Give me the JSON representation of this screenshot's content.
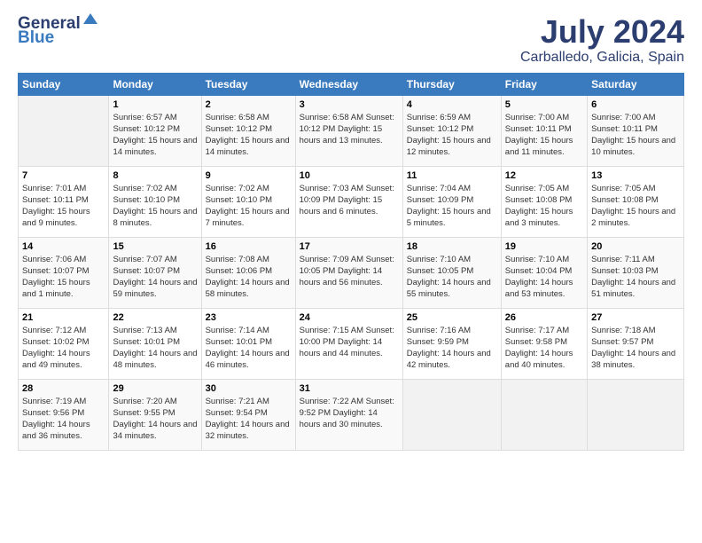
{
  "header": {
    "logo_general": "General",
    "logo_blue": "Blue",
    "month_year": "July 2024",
    "location": "Carballedo, Galicia, Spain"
  },
  "calendar": {
    "headers": [
      "Sunday",
      "Monday",
      "Tuesday",
      "Wednesday",
      "Thursday",
      "Friday",
      "Saturday"
    ],
    "rows": [
      [
        {
          "day": "",
          "info": ""
        },
        {
          "day": "1",
          "info": "Sunrise: 6:57 AM\nSunset: 10:12 PM\nDaylight: 15 hours\nand 14 minutes."
        },
        {
          "day": "2",
          "info": "Sunrise: 6:58 AM\nSunset: 10:12 PM\nDaylight: 15 hours\nand 14 minutes."
        },
        {
          "day": "3",
          "info": "Sunrise: 6:58 AM\nSunset: 10:12 PM\nDaylight: 15 hours\nand 13 minutes."
        },
        {
          "day": "4",
          "info": "Sunrise: 6:59 AM\nSunset: 10:12 PM\nDaylight: 15 hours\nand 12 minutes."
        },
        {
          "day": "5",
          "info": "Sunrise: 7:00 AM\nSunset: 10:11 PM\nDaylight: 15 hours\nand 11 minutes."
        },
        {
          "day": "6",
          "info": "Sunrise: 7:00 AM\nSunset: 10:11 PM\nDaylight: 15 hours\nand 10 minutes."
        }
      ],
      [
        {
          "day": "7",
          "info": "Sunrise: 7:01 AM\nSunset: 10:11 PM\nDaylight: 15 hours\nand 9 minutes."
        },
        {
          "day": "8",
          "info": "Sunrise: 7:02 AM\nSunset: 10:10 PM\nDaylight: 15 hours\nand 8 minutes."
        },
        {
          "day": "9",
          "info": "Sunrise: 7:02 AM\nSunset: 10:10 PM\nDaylight: 15 hours\nand 7 minutes."
        },
        {
          "day": "10",
          "info": "Sunrise: 7:03 AM\nSunset: 10:09 PM\nDaylight: 15 hours\nand 6 minutes."
        },
        {
          "day": "11",
          "info": "Sunrise: 7:04 AM\nSunset: 10:09 PM\nDaylight: 15 hours\nand 5 minutes."
        },
        {
          "day": "12",
          "info": "Sunrise: 7:05 AM\nSunset: 10:08 PM\nDaylight: 15 hours\nand 3 minutes."
        },
        {
          "day": "13",
          "info": "Sunrise: 7:05 AM\nSunset: 10:08 PM\nDaylight: 15 hours\nand 2 minutes."
        }
      ],
      [
        {
          "day": "14",
          "info": "Sunrise: 7:06 AM\nSunset: 10:07 PM\nDaylight: 15 hours\nand 1 minute."
        },
        {
          "day": "15",
          "info": "Sunrise: 7:07 AM\nSunset: 10:07 PM\nDaylight: 14 hours\nand 59 minutes."
        },
        {
          "day": "16",
          "info": "Sunrise: 7:08 AM\nSunset: 10:06 PM\nDaylight: 14 hours\nand 58 minutes."
        },
        {
          "day": "17",
          "info": "Sunrise: 7:09 AM\nSunset: 10:05 PM\nDaylight: 14 hours\nand 56 minutes."
        },
        {
          "day": "18",
          "info": "Sunrise: 7:10 AM\nSunset: 10:05 PM\nDaylight: 14 hours\nand 55 minutes."
        },
        {
          "day": "19",
          "info": "Sunrise: 7:10 AM\nSunset: 10:04 PM\nDaylight: 14 hours\nand 53 minutes."
        },
        {
          "day": "20",
          "info": "Sunrise: 7:11 AM\nSunset: 10:03 PM\nDaylight: 14 hours\nand 51 minutes."
        }
      ],
      [
        {
          "day": "21",
          "info": "Sunrise: 7:12 AM\nSunset: 10:02 PM\nDaylight: 14 hours\nand 49 minutes."
        },
        {
          "day": "22",
          "info": "Sunrise: 7:13 AM\nSunset: 10:01 PM\nDaylight: 14 hours\nand 48 minutes."
        },
        {
          "day": "23",
          "info": "Sunrise: 7:14 AM\nSunset: 10:01 PM\nDaylight: 14 hours\nand 46 minutes."
        },
        {
          "day": "24",
          "info": "Sunrise: 7:15 AM\nSunset: 10:00 PM\nDaylight: 14 hours\nand 44 minutes."
        },
        {
          "day": "25",
          "info": "Sunrise: 7:16 AM\nSunset: 9:59 PM\nDaylight: 14 hours\nand 42 minutes."
        },
        {
          "day": "26",
          "info": "Sunrise: 7:17 AM\nSunset: 9:58 PM\nDaylight: 14 hours\nand 40 minutes."
        },
        {
          "day": "27",
          "info": "Sunrise: 7:18 AM\nSunset: 9:57 PM\nDaylight: 14 hours\nand 38 minutes."
        }
      ],
      [
        {
          "day": "28",
          "info": "Sunrise: 7:19 AM\nSunset: 9:56 PM\nDaylight: 14 hours\nand 36 minutes."
        },
        {
          "day": "29",
          "info": "Sunrise: 7:20 AM\nSunset: 9:55 PM\nDaylight: 14 hours\nand 34 minutes."
        },
        {
          "day": "30",
          "info": "Sunrise: 7:21 AM\nSunset: 9:54 PM\nDaylight: 14 hours\nand 32 minutes."
        },
        {
          "day": "31",
          "info": "Sunrise: 7:22 AM\nSunset: 9:52 PM\nDaylight: 14 hours\nand 30 minutes."
        },
        {
          "day": "",
          "info": ""
        },
        {
          "day": "",
          "info": ""
        },
        {
          "day": "",
          "info": ""
        }
      ]
    ]
  }
}
